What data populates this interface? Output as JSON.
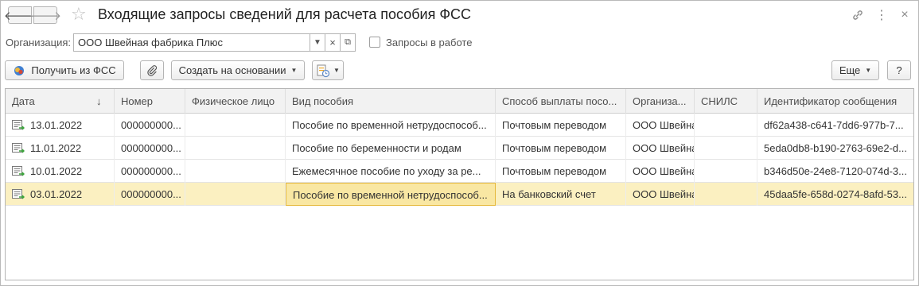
{
  "window": {
    "title": "Входящие запросы сведений для расчета пособия ФСС",
    "icons": {
      "back": "arrow-left-icon",
      "forward": "arrow-right-icon",
      "favorite": "star-icon",
      "link": "link-icon",
      "more": "more-vertical-icon",
      "close": "close-icon"
    },
    "glyphs": {
      "back": "🡐",
      "forward": "🡒",
      "star": "☆",
      "link": "🔗",
      "more": "⋮",
      "close": "×"
    }
  },
  "filters": {
    "organization_label": "Организация:",
    "organization_value": "ООО Швейная фабрика Плюс",
    "in_work_label": "Запросы в работе",
    "in_work_checked": false
  },
  "toolbar": {
    "get_from_fss": "Получить из ФСС",
    "create_based_on": "Создать на основании",
    "more": "Еще",
    "help": "?"
  },
  "table": {
    "columns": [
      "Дата",
      "Номер",
      "Физическое лицо",
      "Вид пособия",
      "Способ выплаты посо...",
      "Организа...",
      "СНИЛС",
      "Идентификатор сообщения"
    ],
    "sort_indicator": "↓",
    "rows": [
      {
        "date": "13.01.2022",
        "number": "000000000...",
        "person": "",
        "benefit": "Пособие по временной нетрудоспособ...",
        "payment": "Почтовым переводом",
        "org": "ООО Швейна",
        "snils": "",
        "msg_id": "df62a438-c641-7dd6-977b-7..."
      },
      {
        "date": "11.01.2022",
        "number": "000000000...",
        "person": "",
        "benefit": "Пособие по беременности и родам",
        "payment": "Почтовым переводом",
        "org": "ООО Швейна",
        "snils": "",
        "msg_id": "5eda0db8-b190-2763-69e2-d..."
      },
      {
        "date": "10.01.2022",
        "number": "000000000...",
        "person": "",
        "benefit": "Ежемесячное пособие по уходу за ре...",
        "payment": "Почтовым переводом",
        "org": "ООО Швейна",
        "snils": "",
        "msg_id": "b346d50e-24e8-7120-074d-3..."
      },
      {
        "date": "03.01.2022",
        "number": "000000000...",
        "person": "",
        "benefit": "Пособие по временной нетрудоспособ...",
        "payment": "На банковский счет",
        "org": "ООО Швейна",
        "snils": "",
        "msg_id": "45daa5fe-658d-0274-8afd-53..."
      }
    ],
    "selected_row": 3
  }
}
